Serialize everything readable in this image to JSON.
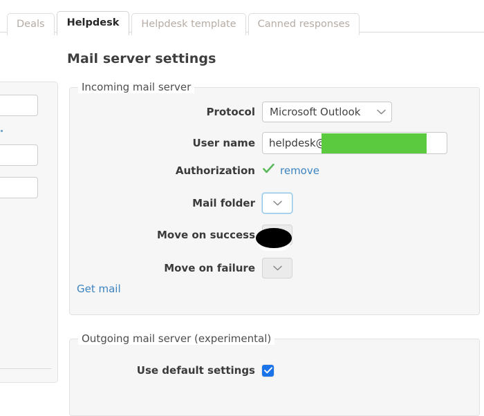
{
  "tabs": [
    {
      "label": "Deals",
      "active": false
    },
    {
      "label": "Helpdesk",
      "active": true
    },
    {
      "label": "Helpdesk template",
      "active": false
    },
    {
      "label": "Canned responses",
      "active": false
    }
  ],
  "page": {
    "title": "Mail server settings"
  },
  "incoming": {
    "legend": "Incoming mail server",
    "protocol": {
      "label": "Protocol",
      "value": "Microsoft Outlook",
      "caret": "chevron-down-icon"
    },
    "username": {
      "label": "User name",
      "value": "helpdesk@",
      "redacted": true
    },
    "authorization": {
      "label": "Authorization",
      "status_icon": "check-icon",
      "action_label": "remove"
    },
    "mail_folder": {
      "label": "Mail folder",
      "value": "",
      "focused": true
    },
    "move_on_success": {
      "label": "Move on success",
      "value": "",
      "disabled": true
    },
    "move_on_failure": {
      "label": "Move on failure",
      "value": "",
      "disabled": true
    },
    "get_mail_link": "Get mail"
  },
  "outgoing": {
    "legend": "Outgoing mail server (experimental)",
    "use_default": {
      "label": "Use default settings",
      "checked": true
    }
  },
  "colors": {
    "accent_link": "#3b83c0",
    "check_green": "#5cb85c",
    "redaction_green": "#5cca3f",
    "checkbox_blue": "#1a73e8",
    "focus_blue": "#8ec5e8"
  }
}
